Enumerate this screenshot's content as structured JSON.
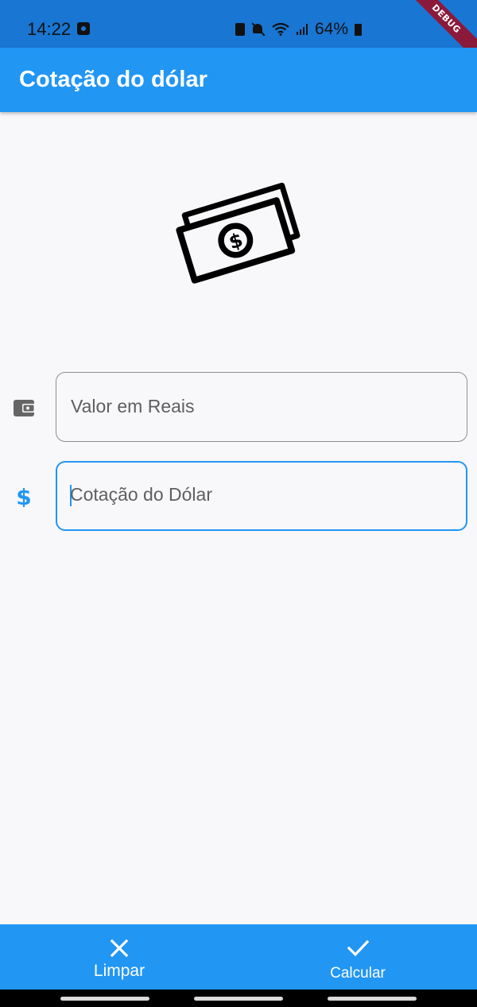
{
  "status_bar": {
    "time": "14:22",
    "battery_percent": "64%",
    "icons": [
      "notification-icon",
      "lock-icon",
      "mute-icon",
      "wifi-icon",
      "signal-icon",
      "battery-icon"
    ]
  },
  "debug_banner": "DEBUG",
  "app_bar": {
    "title": "Cotação do dólar"
  },
  "illustration": {
    "icon": "money-bill-icon"
  },
  "form": {
    "reais_field": {
      "icon": "wallet-icon",
      "placeholder": "Valor em Reais",
      "value": ""
    },
    "dollar_field": {
      "icon": "dollar-icon",
      "placeholder": "Cotação do Dólar",
      "value": "",
      "focused": true
    }
  },
  "bottom_bar": {
    "clear": {
      "icon": "close-icon",
      "label": "Limpar"
    },
    "calculate": {
      "icon": "check-icon",
      "label": "Calcular"
    }
  },
  "colors": {
    "primary": "#2196f3",
    "status_bar": "#1976d2",
    "background": "#f8f7fa",
    "debug": "#8b1a3a"
  }
}
